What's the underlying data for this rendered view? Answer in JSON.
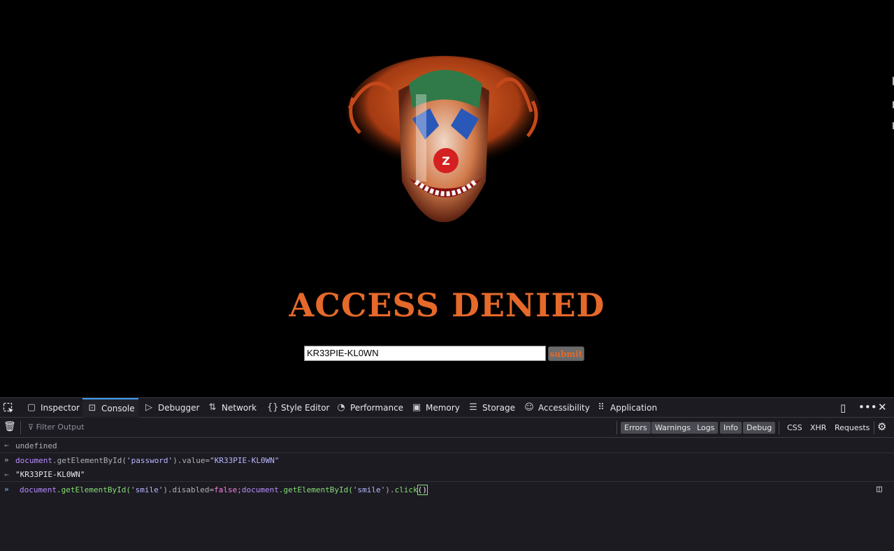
{
  "page": {
    "heading": "ACCESS DENIED",
    "password_value": "KR33PIE-KL0WN",
    "submit_label": "submit",
    "accent_color": "#e5692a"
  },
  "devtools": {
    "tabs": [
      {
        "label": "Inspector",
        "icon": "inspector-icon"
      },
      {
        "label": "Console",
        "icon": "console-icon",
        "active": true
      },
      {
        "label": "Debugger",
        "icon": "debugger-icon"
      },
      {
        "label": "Network",
        "icon": "network-icon"
      },
      {
        "label": "Style Editor",
        "icon": "style-editor-icon"
      },
      {
        "label": "Performance",
        "icon": "performance-icon"
      },
      {
        "label": "Memory",
        "icon": "memory-icon"
      },
      {
        "label": "Storage",
        "icon": "storage-icon"
      },
      {
        "label": "Accessibility",
        "icon": "accessibility-icon"
      },
      {
        "label": "Application",
        "icon": "application-icon"
      }
    ],
    "filter_placeholder": "Filter Output",
    "level_filters": [
      "Errors",
      "Warnings",
      "Logs",
      "Info",
      "Debug"
    ],
    "type_filters": [
      "CSS",
      "XHR",
      "Requests"
    ],
    "console": {
      "result_1": "undefined",
      "command_1": {
        "part1": "document",
        "part2": ".getElementById(",
        "part3": "'password'",
        "part4": ").value=",
        "part5": "\"KR33PIE-KL0WN\""
      },
      "result_2": "\"KR33PIE-KL0WN\"",
      "input": {
        "p1": "document",
        "p2": ".getElementById(",
        "p3": "'smile'",
        "p4": ").disabled=",
        "p5": "false",
        "p6": ";",
        "p7": "document",
        "p8": ".getElementById(",
        "p9": "'smile'",
        "p10": ").",
        "p11": "click",
        "p12": "()"
      }
    }
  }
}
